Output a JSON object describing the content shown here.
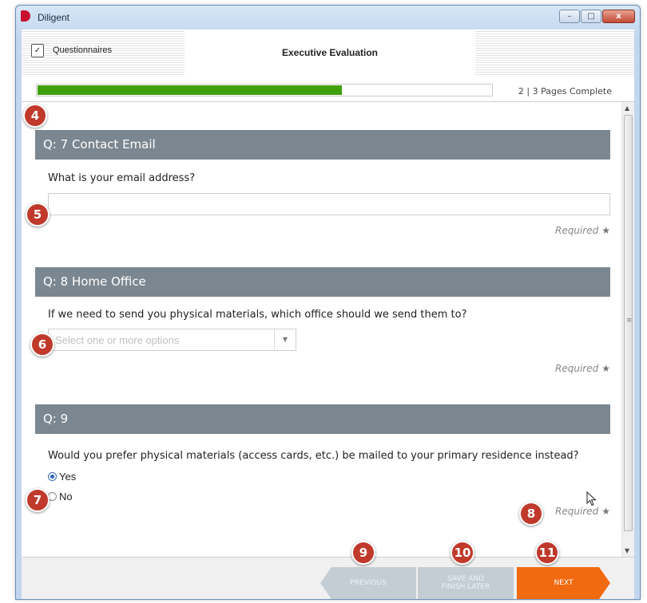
{
  "window": {
    "app_title": "Diligent",
    "controls": {
      "minimize": "–",
      "maximize": "□",
      "close": "x"
    }
  },
  "tabs": {
    "questionnaires_label": "Questionnaires",
    "questionnaires_check": "✓",
    "active_title": "Executive Evaluation"
  },
  "progress": {
    "fraction_complete": 0.67,
    "label": "2 | 3   Pages Complete"
  },
  "questions": [
    {
      "header": "Q: 7  Contact Email",
      "text": "What is your email address?",
      "input_value": "",
      "required": "Required"
    },
    {
      "header": "Q: 8  Home Office",
      "text": "If we need to send you physical materials, which office should we send them to?",
      "select_placeholder": "Select one or more options",
      "required": "Required"
    },
    {
      "header": "Q: 9",
      "text": "Would you prefer physical materials (access cards, etc.) be mailed to your primary residence instead?",
      "options": [
        {
          "label": "Yes",
          "selected": true
        },
        {
          "label": "No",
          "selected": false
        }
      ],
      "required": "Required"
    }
  ],
  "required_star": "★",
  "footer": {
    "previous": "PREVIOUS",
    "save_line1": "SAVE AND",
    "save_line2": "FINISH LATER",
    "next": "NEXT"
  },
  "annotations": [
    "4",
    "5",
    "6",
    "7",
    "8",
    "9",
    "10",
    "11"
  ],
  "colors": {
    "progress_fill": "#3fa00a",
    "question_header": "#7b8790",
    "next_button": "#f26a0f",
    "disabled_button": "#c4cdd3",
    "badge": "#c0392b"
  },
  "icons": {
    "dropdown": "▼",
    "scroll_up": "▲",
    "scroll_down": "▼",
    "scroll_grip": "≡"
  }
}
